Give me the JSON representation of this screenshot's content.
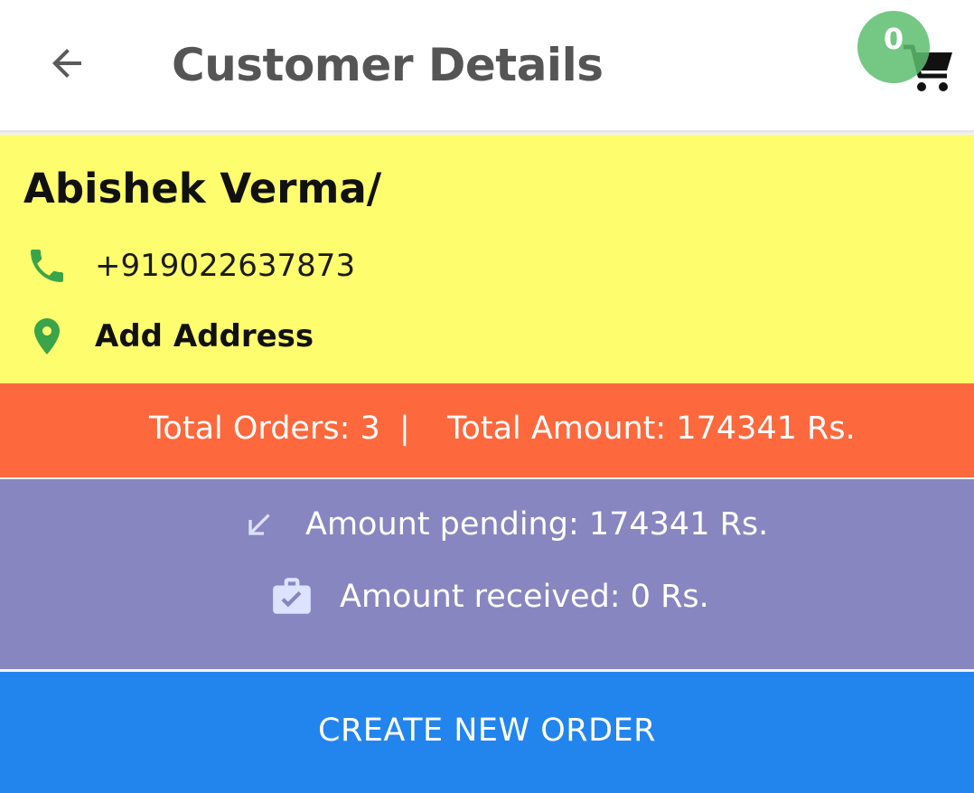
{
  "header": {
    "title": "Customer Details",
    "cart_count": "0",
    "icons": {
      "back": "arrow-left-icon",
      "cart": "shopping-cart-icon"
    }
  },
  "customer": {
    "name": "Abishek Verma/",
    "phone": "+919022637873",
    "address_label": "Add Address",
    "icons": {
      "phone": "phone-icon",
      "address": "location-pin-icon"
    }
  },
  "summary": {
    "total_orders": "Total Orders: 3",
    "separator": "|",
    "total_amount": "Total Amount: 174341 Rs."
  },
  "payments": {
    "pending": "Amount pending: 174341 Rs.",
    "received": "Amount received: 0 Rs.",
    "icons": {
      "pending": "arrow-down-left-icon",
      "received": "briefcase-check-icon"
    }
  },
  "actions": {
    "create_order": "CREATE NEW ORDER"
  },
  "colors": {
    "customer_card": "#fdfd6e",
    "totals_band": "#fe683d",
    "payment_band": "#8886c0",
    "primary_button": "#2285ee",
    "icon_green": "#3aa44a",
    "badge_green": "#5cbe6e"
  }
}
